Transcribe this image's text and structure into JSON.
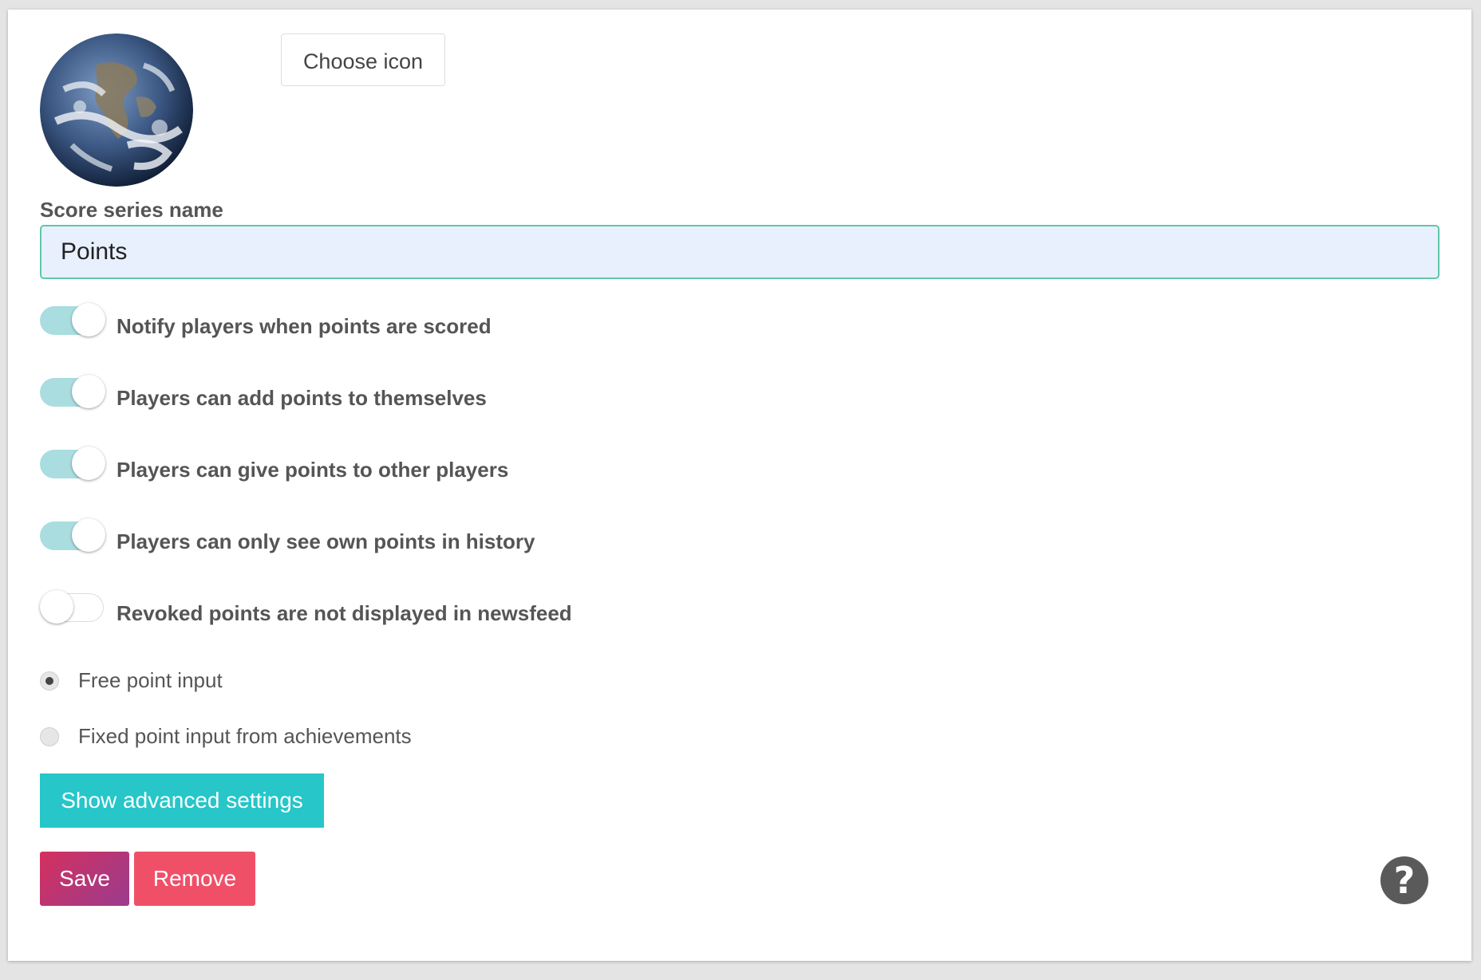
{
  "icon": {
    "choose_label": "Choose icon",
    "preview": "earth-globe-icon"
  },
  "series_name": {
    "label": "Score series name",
    "value": "Points"
  },
  "toggles": [
    {
      "label": "Notify players when points are scored",
      "on": true
    },
    {
      "label": "Players can add points to themselves",
      "on": true
    },
    {
      "label": "Players can give points to other players",
      "on": true
    },
    {
      "label": "Players can only see own points in history",
      "on": true
    },
    {
      "label": "Revoked points are not displayed in newsfeed",
      "on": false
    }
  ],
  "point_input": {
    "options": [
      {
        "label": "Free point input",
        "checked": true
      },
      {
        "label": "Fixed point input from achievements",
        "checked": false
      }
    ]
  },
  "actions": {
    "advanced_label": "Show advanced settings",
    "save_label": "Save",
    "remove_label": "Remove",
    "help_icon": "question-mark-icon",
    "help_glyph": "?"
  },
  "colors": {
    "toggle_on_track": "#a9dde0",
    "input_border": "#5dc8a8",
    "input_background": "#e8f0fe",
    "advanced_button": "#26c6c9",
    "save_gradient": [
      "#d4305e",
      "#9a3c8e"
    ],
    "remove_button": "#ef5068"
  }
}
